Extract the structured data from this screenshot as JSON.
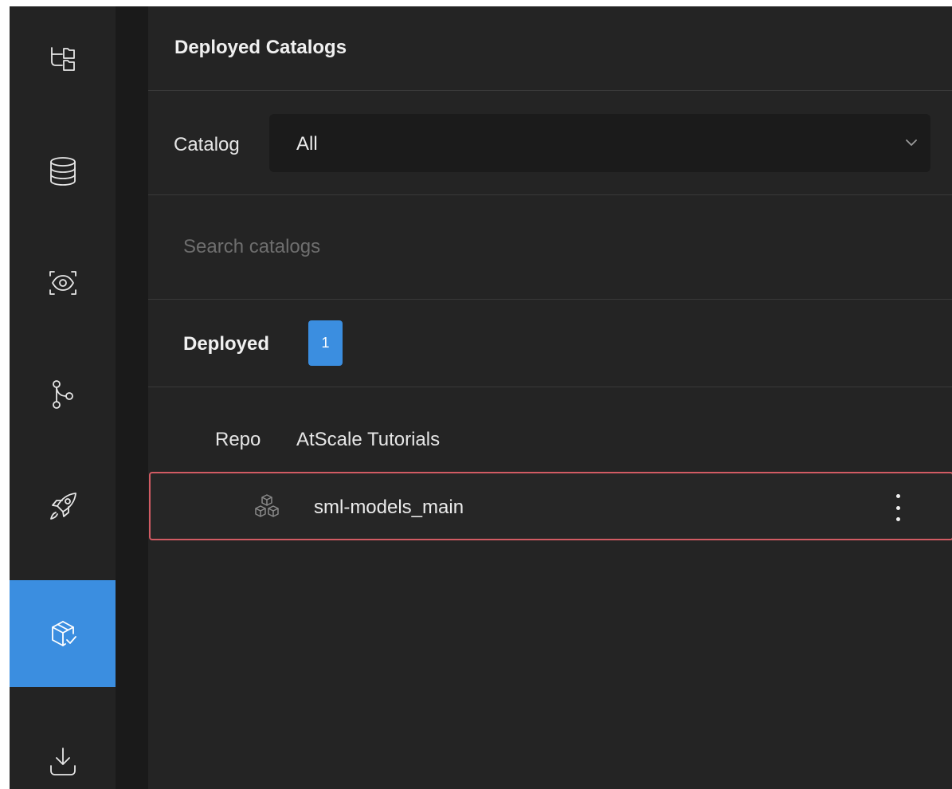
{
  "activity_bar": {
    "items": [
      {
        "icon": "tree-icon",
        "active": false
      },
      {
        "icon": "database-icon",
        "active": false
      },
      {
        "icon": "eye-icon",
        "active": false
      },
      {
        "icon": "git-branch-icon",
        "active": false
      },
      {
        "icon": "rocket-icon",
        "active": false
      },
      {
        "icon": "package-check-icon",
        "active": true
      },
      {
        "icon": "download-icon",
        "active": false
      }
    ],
    "active_color": "#3b8ee0"
  },
  "panel": {
    "title": "Deployed Catalogs",
    "catalog_filter": {
      "label": "Catalog",
      "selected": "All"
    },
    "search": {
      "placeholder": "Search catalogs",
      "value": ""
    },
    "deployed_section": {
      "label": "Deployed",
      "count": "1"
    },
    "repo": {
      "key": "Repo",
      "value": "AtScale Tutorials"
    },
    "catalogs": [
      {
        "name": "sml-models_main",
        "icon": "cubes-icon",
        "highlighted": true
      }
    ]
  },
  "colors": {
    "accent": "#3b8ee0",
    "highlight_border": "#d15b63",
    "background": "#232323"
  }
}
